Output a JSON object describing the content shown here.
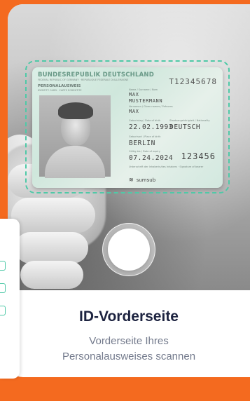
{
  "screen": {
    "title": "ID-Vorderseite",
    "subtitle_line1": "Vorderseite Ihres",
    "subtitle_line2": "Personalausweises scannen",
    "accent_color": "#4fc9a7",
    "background_color": "#f46a1f"
  },
  "id_card": {
    "header": "BUNDESREPUBLIK DEUTSCHLAND",
    "header_sub": "FEDERAL REPUBLIC OF GERMANY · REPUBLIQUE FEDERALE D'ALLEMAGNE",
    "doc_type": "PERSONALAUSWEIS",
    "doc_type_sub": "IDENTITY CARD · CARTE D'IDENTITE",
    "number": "T12345678",
    "surname_label": "Name / Surname / Nom",
    "surname": "MAX",
    "surname2": "MUSTERMANN",
    "given_label": "Vornamen / Given names / Prénoms",
    "given_name": "MAX",
    "dob_label": "Geburtstag / Date of birth",
    "dob": "22.02.1993",
    "nationality_label": "Staatsangehörigkeit / Nationality",
    "nationality": "DEUTSCH",
    "pob_label": "Geburtsort / Place of birth",
    "place_of_birth": "BERLIN",
    "expiry_label": "Gültig bis / Date of expiry",
    "expiry": "07.24.2024",
    "can": "123456",
    "signature_label": "Unterschrift der Inhaberin/des Inhabers · Signature of bearer",
    "brand": "sumsub",
    "brand_icon": "sumsub-logo-icon"
  },
  "controls": {
    "shutter_icon": "shutter-button-icon"
  }
}
